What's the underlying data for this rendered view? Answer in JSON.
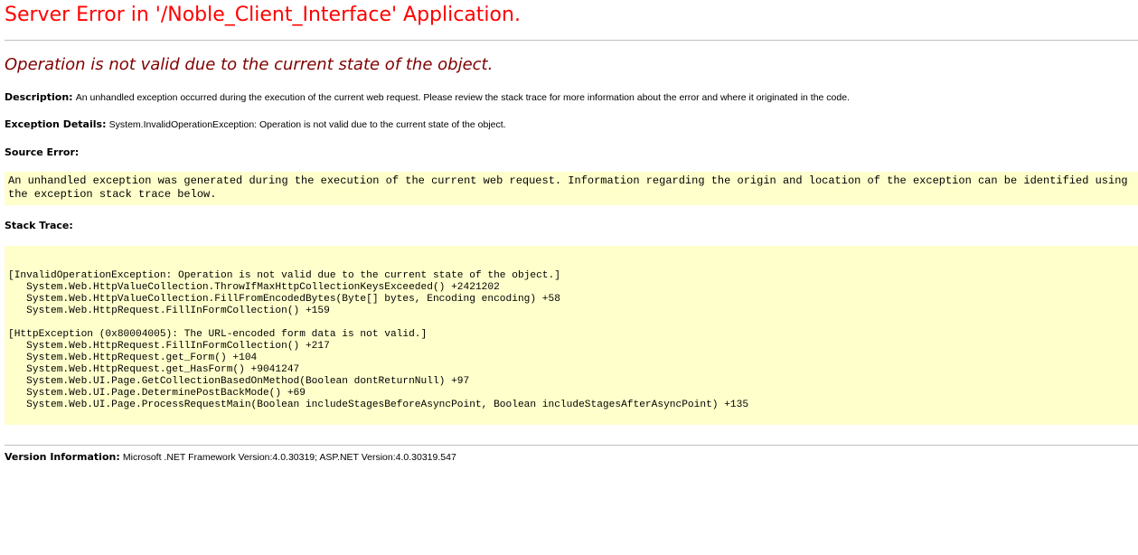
{
  "title": "Server Error in '/Noble_Client_Interface' Application.",
  "subtitle": "Operation is not valid due to the current state of the object.",
  "description": {
    "label": "Description:",
    "text": "An unhandled exception occurred during the execution of the current web request. Please review the stack trace for more information about the error and where it originated in the code."
  },
  "exception_details": {
    "label": "Exception Details:",
    "text": "System.InvalidOperationException: Operation is not valid due to the current state of the object."
  },
  "source_error": {
    "label": "Source Error:",
    "text": "An unhandled exception was generated during the execution of the current web request. Information regarding the origin and location of the exception can be identified using the exception stack trace below."
  },
  "stack_trace": {
    "label": "Stack Trace:",
    "lines": [
      "[InvalidOperationException: Operation is not valid due to the current state of the object.]",
      "   System.Web.HttpValueCollection.ThrowIfMaxHttpCollectionKeysExceeded() +2421202",
      "   System.Web.HttpValueCollection.FillFromEncodedBytes(Byte[] bytes, Encoding encoding) +58",
      "   System.Web.HttpRequest.FillInFormCollection() +159",
      "[HttpException (0x80004005): The URL-encoded form data is not valid.]",
      "   System.Web.HttpRequest.FillInFormCollection() +217",
      "   System.Web.HttpRequest.get_Form() +104",
      "   System.Web.HttpRequest.get_HasForm() +9041247",
      "   System.Web.UI.Page.GetCollectionBasedOnMethod(Boolean dontReturnNull) +97",
      "   System.Web.UI.Page.DeterminePostBackMode() +69",
      "   System.Web.UI.Page.ProcessRequestMain(Boolean includeStagesBeforeAsyncPoint, Boolean includeStagesAfterAsyncPoint) +135"
    ]
  },
  "version_information": {
    "label": "Version Information:",
    "text": "Microsoft .NET Framework Version:4.0.30319; ASP.NET Version:4.0.30319.547"
  },
  "colors": {
    "title": "#ff0000",
    "subtitle": "#800000",
    "code_background": "#ffffcc",
    "rule": "#c0c0c0"
  }
}
